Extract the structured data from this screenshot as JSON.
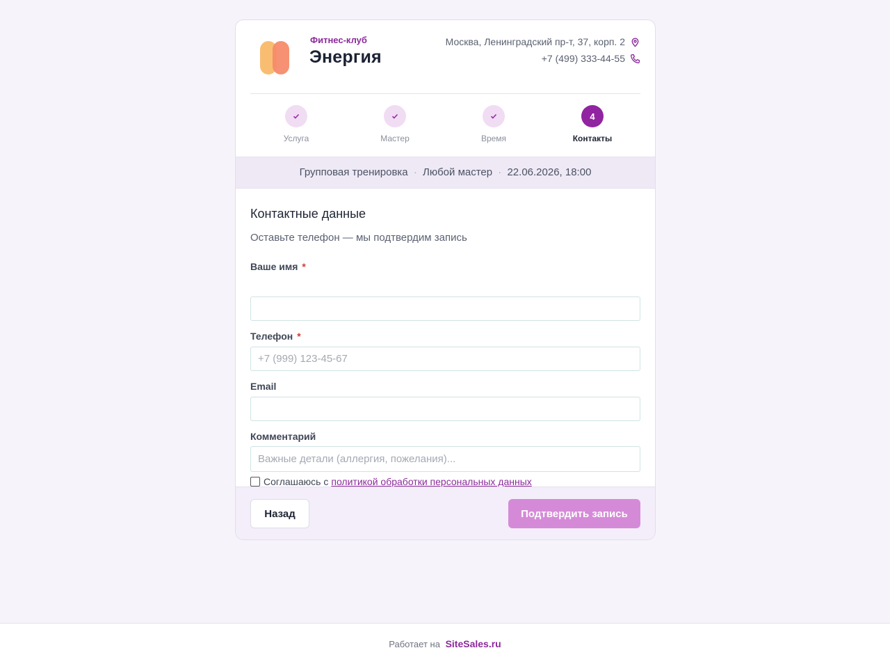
{
  "club": {
    "subtitle": "Фитнес-клуб",
    "name": "Энергия",
    "address": "Москва, Ленинградский пр-т, 37, корп. 2",
    "phone": "+7 (499) 333-44-55"
  },
  "steps": [
    {
      "label": "Услуга",
      "state": "done",
      "icon": "check-icon"
    },
    {
      "label": "Мастер",
      "state": "done",
      "icon": "check-icon"
    },
    {
      "label": "Время",
      "state": "done",
      "icon": "check-icon"
    },
    {
      "label": "Контакты",
      "state": "active",
      "number": "4"
    }
  ],
  "summary": {
    "service": "Групповая тренировка",
    "master": "Любой мастер",
    "datetime": "22.06.2026, 18:00",
    "separator": "·"
  },
  "form": {
    "title": "Контактные данные",
    "subtitle": "Оставьте телефон — мы подтвердим запись",
    "required_mark": "*",
    "name": {
      "label": "Ваше имя",
      "value": "",
      "placeholder": ""
    },
    "phone": {
      "label": "Телефон",
      "value": "",
      "placeholder": "+7 (999) 123-45-67"
    },
    "email": {
      "label": "Email",
      "value": "",
      "placeholder": ""
    },
    "comment": {
      "label": "Комментарий",
      "value": "",
      "placeholder": "Важные детали (аллергия, пожелания)..."
    },
    "consent": {
      "text": "Соглашаюсь с",
      "link": "политикой обработки персональных данных",
      "checked": false
    }
  },
  "actions": {
    "back": "Назад",
    "confirm": "Подтвердить запись"
  },
  "footer": {
    "powered": "Работает на",
    "site": "SiteSales.ru"
  },
  "colors": {
    "accent": "#9124a0",
    "accent_light": "#f0dcf3",
    "confirm_disabled": "#d58ad8",
    "background": "#f6f3fa"
  }
}
